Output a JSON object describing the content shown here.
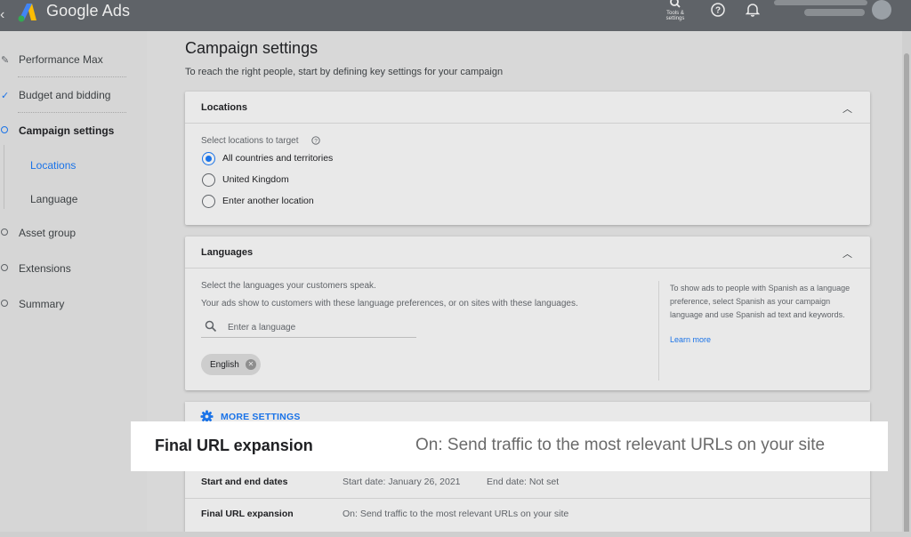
{
  "app": {
    "brand": "Google Ads"
  },
  "topbar": {
    "tools_label": "Tools & settings"
  },
  "sidebar": {
    "items": [
      {
        "label": "Performance Max",
        "state": "done",
        "icon": "pencil-icon"
      },
      {
        "label": "Budget and bidding",
        "state": "done",
        "icon": "check-icon"
      },
      {
        "label": "Campaign settings",
        "state": "current",
        "icon": "circle-icon"
      },
      {
        "label": "Asset group",
        "state": "todo",
        "icon": "circle-icon"
      },
      {
        "label": "Extensions",
        "state": "todo",
        "icon": "circle-icon"
      },
      {
        "label": "Summary",
        "state": "todo",
        "icon": "circle-icon"
      }
    ],
    "subitems": [
      {
        "label": "Locations",
        "selected": true
      },
      {
        "label": "Language",
        "selected": false
      }
    ]
  },
  "page": {
    "title": "Campaign settings",
    "subtitle": "To reach the right people, start by defining key settings for your campaign"
  },
  "locations": {
    "title": "Locations",
    "prompt": "Select locations to target",
    "options": [
      {
        "label": "All countries and territories",
        "selected": true
      },
      {
        "label": "United Kingdom",
        "selected": false
      },
      {
        "label": "Enter another location",
        "selected": false
      }
    ]
  },
  "languages": {
    "title": "Languages",
    "prompt": "Select the languages your customers speak.",
    "description": "Your ads show to customers with these language preferences, or on sites with these languages.",
    "search_placeholder": "Enter a language",
    "chips": [
      "English"
    ],
    "aside": "To show ads to people with Spanish as a language preference, select Spanish as your campaign language and use Spanish ad text and keywords.",
    "aside_link": "Learn more"
  },
  "more_settings": {
    "label": "MORE SETTINGS",
    "rows": [
      {
        "key": "Start and end dates",
        "value": "Start date: January 26, 2021",
        "value2": "End date: Not set"
      },
      {
        "key": "Final URL expansion",
        "value": "On: Send traffic to the most relevant URLs on your site"
      }
    ]
  },
  "highlight": {
    "key": "Final URL expansion",
    "value": "On: Send traffic to the most relevant URLs on your site"
  },
  "colors": {
    "accent": "#1a73e8",
    "topbar": "#5f6368"
  }
}
